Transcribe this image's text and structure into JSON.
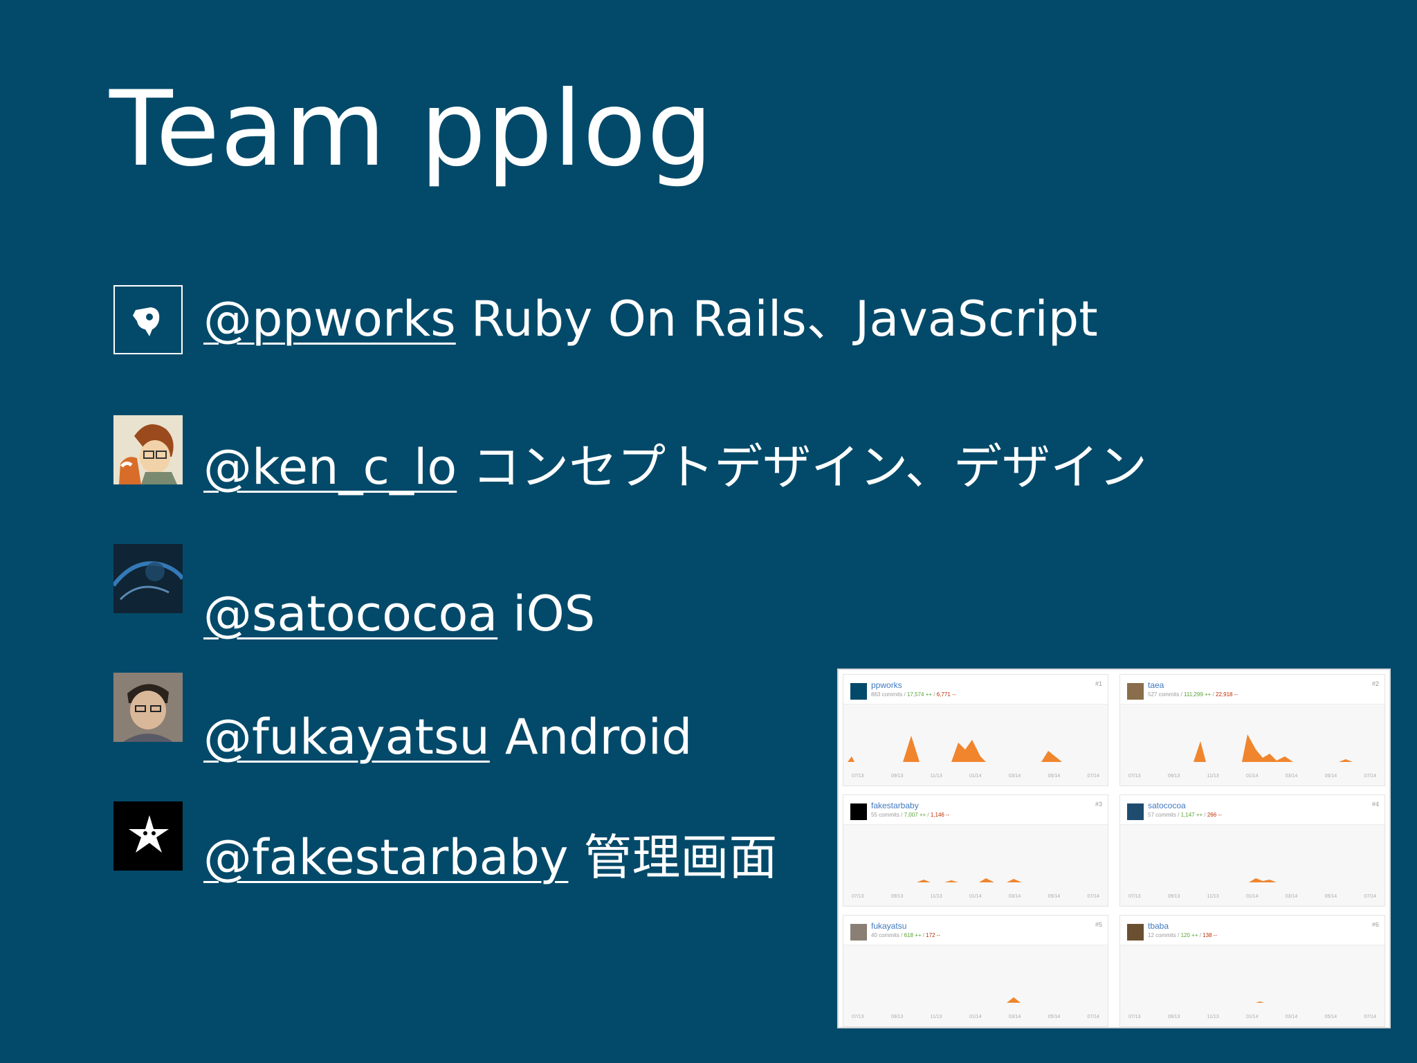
{
  "slide": {
    "title": "Team pplog",
    "background": "#034a6a"
  },
  "members": [
    {
      "handle": "@ppworks",
      "role": "Ruby On Rails、JavaScript",
      "avatar_icon": "ppworks-logo-icon"
    },
    {
      "handle": "@ken_c_lo",
      "role": "コンセプトデザイン、デザイン",
      "avatar_icon": "ken-c-lo-avatar"
    },
    {
      "handle": "@satococoa",
      "role": "iOS",
      "avatar_icon": "satococoa-avatar"
    },
    {
      "handle": "@fukayatsu",
      "role": "Android",
      "avatar_icon": "fukayatsu-avatar"
    },
    {
      "handle": "@fakestarbaby",
      "role": "管理画面",
      "avatar_icon": "fakestarbaby-star-icon"
    }
  ],
  "contributors": [
    {
      "name": "ppworks",
      "commits": "863 commits",
      "additions": "17,574 ++",
      "deletions": "6,771 --",
      "rank": "#1"
    },
    {
      "name": "taea",
      "commits": "527 commits",
      "additions": "111,299 ++",
      "deletions": "22,918 --",
      "rank": "#2"
    },
    {
      "name": "fakestarbaby",
      "commits": "55 commits",
      "additions": "7,007 ++",
      "deletions": "1,146 --",
      "rank": "#3"
    },
    {
      "name": "satococoa",
      "commits": "57 commits",
      "additions": "1,147 ++",
      "deletions": "266 --",
      "rank": "#4"
    },
    {
      "name": "fukayatsu",
      "commits": "40 commits",
      "additions": "618 ++",
      "deletions": "172 --",
      "rank": "#5"
    },
    {
      "name": "tbaba",
      "commits": "12 commits",
      "additions": "120 ++",
      "deletions": "138 --",
      "rank": "#6"
    }
  ],
  "graph_months": [
    "07/13",
    "09/13",
    "11/13",
    "01/14",
    "03/14",
    "05/14",
    "07/14"
  ],
  "colors": {
    "graph_fill": "#f0852d",
    "link": "#4078c0"
  }
}
